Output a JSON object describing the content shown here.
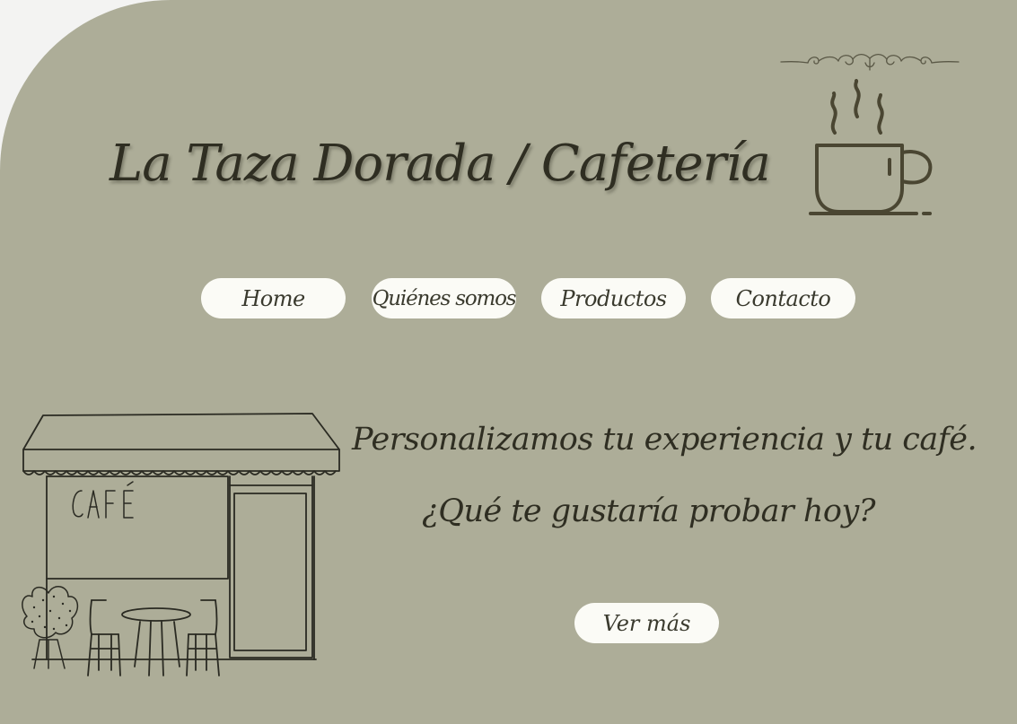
{
  "header": {
    "title": "La Taza Dorada / Cafetería"
  },
  "nav": {
    "items": [
      {
        "label": "Home"
      },
      {
        "label": "Quiénes somos"
      },
      {
        "label": "Productos"
      },
      {
        "label": "Contacto"
      }
    ]
  },
  "hero": {
    "line1": "Personalizamos tu experiencia y tu café.",
    "line2": "¿Qué te gustaría probar hoy?",
    "cta_label": "Ver más",
    "illustration_sign": "CAFÉ"
  },
  "colors": {
    "background": "#adad98",
    "button": "#fbfbf6",
    "text": "#2f2e22",
    "icon_stroke": "#4a4632"
  },
  "icons": [
    "ornament-flourish-icon",
    "coffee-cup-icon",
    "cafe-storefront-illustration"
  ]
}
